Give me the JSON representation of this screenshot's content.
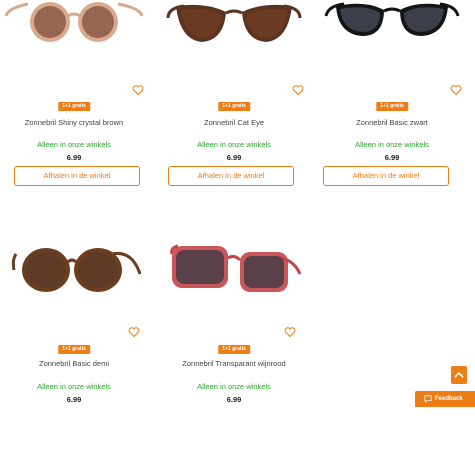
{
  "colors": {
    "accent": "#ee7d16",
    "availability": "#2aa52c"
  },
  "products": [
    {
      "name": "Zonnebril Shiny crystal brown",
      "badge": "1+1 gratis",
      "availability": "Alleen in onze winkels",
      "price": "6.99",
      "button": "Afhalen in de winkel",
      "frame_color": "#d9a98d",
      "lens_color": "#8a5a48"
    },
    {
      "name": "Zonnebril Cat Eye",
      "badge": "1+1 gratis",
      "availability": "Alleen in onze winkels",
      "price": "6.99",
      "button": "Afhalen in de winkel",
      "frame_color": "#5a3420",
      "lens_color": "#6b3a22"
    },
    {
      "name": "Zonnebril Basic zwart",
      "badge": "1+1 gratis",
      "availability": "Alleen in onze winkels",
      "price": "6.99",
      "button": "Afhalen in de winkel",
      "frame_color": "#151515",
      "lens_color": "#3c3f4a"
    },
    {
      "name": "Zonnebril Basic demi",
      "badge": "1+1 gratis",
      "availability": "Alleen in onze winkels",
      "price": "6.99",
      "frame_color": "#6a3e1f",
      "lens_color": "#5e3b26"
    },
    {
      "name": "Zonnebril Transparant wijnrood",
      "badge": "1+1 gratis",
      "availability": "Alleen in onze winkels",
      "price": "6.99",
      "frame_color": "#c2454a",
      "lens_color": "#3f3b45"
    }
  ],
  "widgets": {
    "scroll_top_icon": "chevron-up-icon",
    "feedback_label": "Feedback",
    "feedback_icon": "chat-bubble-icon"
  }
}
